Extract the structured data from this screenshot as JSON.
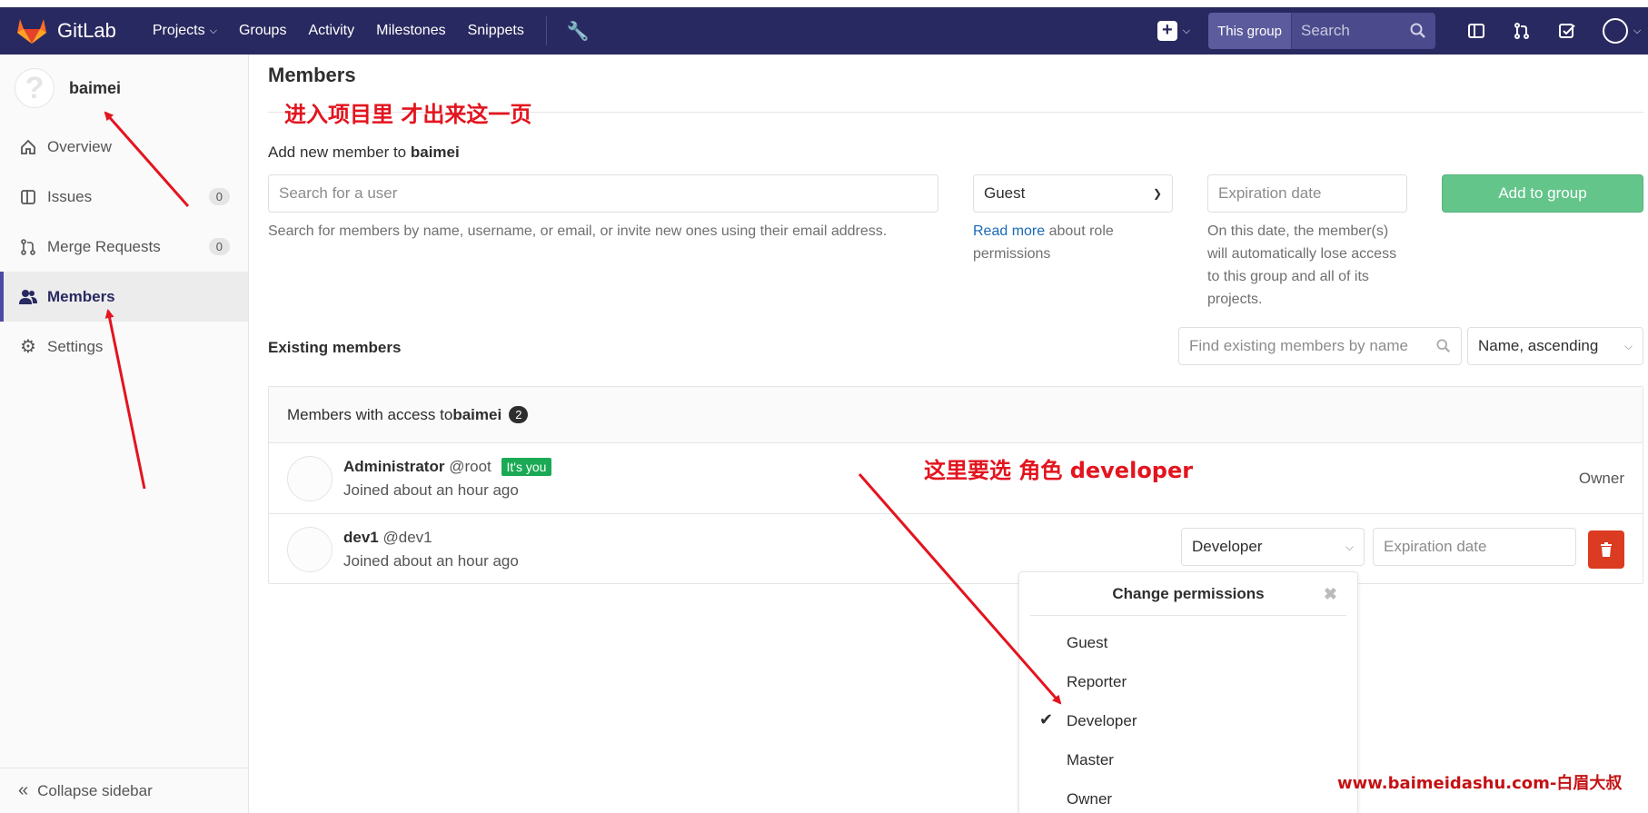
{
  "nav": {
    "brand": "GitLab",
    "links": [
      "Projects",
      "Groups",
      "Activity",
      "Milestones",
      "Snippets"
    ],
    "search_scope": "This group",
    "search_placeholder": "Search"
  },
  "sidebar": {
    "group_name": "baimei",
    "avatar_glyph": "?",
    "items": [
      {
        "label": "Overview"
      },
      {
        "label": "Issues",
        "count": "0"
      },
      {
        "label": "Merge Requests",
        "count": "0"
      },
      {
        "label": "Members"
      },
      {
        "label": "Settings"
      }
    ],
    "collapse_label": "Collapse sidebar"
  },
  "main": {
    "title": "Members",
    "add_member_prefix": "Add new member to ",
    "group_name": "baimei",
    "search_user_placeholder": "Search for a user",
    "search_help": "Search for members by name, username, or email, or invite new ones using their email address.",
    "role_selected": "Guest",
    "read_more": "Read more",
    "role_help_rest": " about role permissions",
    "expiration_placeholder": "Expiration date",
    "expiration_help": "On this date, the member(s) will automatically lose access to this group and all of its projects.",
    "add_button": "Add to group",
    "existing_label": "Existing members",
    "find_placeholder": "Find existing members by name",
    "sort_selected": "Name, ascending",
    "panel_prefix": "Members with access to ",
    "member_count": "2",
    "members": [
      {
        "name": "Administrator",
        "username": "@root",
        "badge": "It's you",
        "joined": "Joined about an hour ago",
        "role": "Owner"
      },
      {
        "name": "dev1",
        "username": "@dev1",
        "joined": "Joined about an hour ago",
        "role": "Developer",
        "expiration_placeholder": "Expiration date"
      }
    ],
    "dropdown": {
      "title": "Change permissions",
      "options": [
        "Guest",
        "Reporter",
        "Developer",
        "Master",
        "Owner"
      ],
      "selected": "Developer"
    }
  },
  "annotations": {
    "note1": "进入项目里 才出来这一页",
    "note2": "这里要选 角色   developer",
    "watermark": "www.baimeidashu.com-白眉大叔",
    "color": "#e3141e"
  },
  "colors": {
    "navbar": "#292961",
    "add_button": "#63c58a",
    "delete_button": "#db3b21",
    "badge_green": "#1aaa55"
  }
}
